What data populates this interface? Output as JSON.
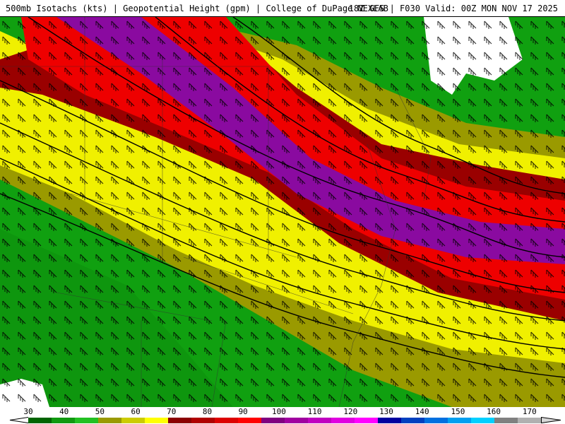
{
  "header": {
    "left_title": "500mb Isotachs (kts) | Geopotential Height (gpm) | College of DuPage NEXLAB",
    "right_title": "18Z GFS | F030 Valid: 00Z MON NOV 17 2025"
  },
  "map": {
    "product": "500mb isotachs with wind barbs and geopotential height contours",
    "bands": [
      {
        "range": "30-50 kts",
        "color": "#10a010"
      },
      {
        "range": "50-60 kts",
        "color": "#9a9a00"
      },
      {
        "range": "60-70 kts",
        "color": "#f0f000"
      },
      {
        "range": "70-80 kts",
        "color": "#9a0000"
      },
      {
        "range": "80-100 kts",
        "color": "#ee0000"
      },
      {
        "range": "100-110 kts",
        "color": "#8a0aa0"
      }
    ]
  },
  "colorbar": {
    "ticks": [
      "30",
      "40",
      "50",
      "60",
      "70",
      "80",
      "90",
      "100",
      "110",
      "120",
      "130",
      "140",
      "150",
      "160",
      "170"
    ],
    "colors": [
      "#006400",
      "#109910",
      "#22c022",
      "#9a9a00",
      "#cccc00",
      "#ffff00",
      "#8b0000",
      "#b00000",
      "#dd0000",
      "#ff0000",
      "#800080",
      "#a000a0",
      "#c000c0",
      "#e000e0",
      "#ff00ff",
      "#0000a0",
      "#0040c0",
      "#0070e0",
      "#00a0f0",
      "#00d0ff",
      "#808080",
      "#b0b0b0"
    ]
  }
}
